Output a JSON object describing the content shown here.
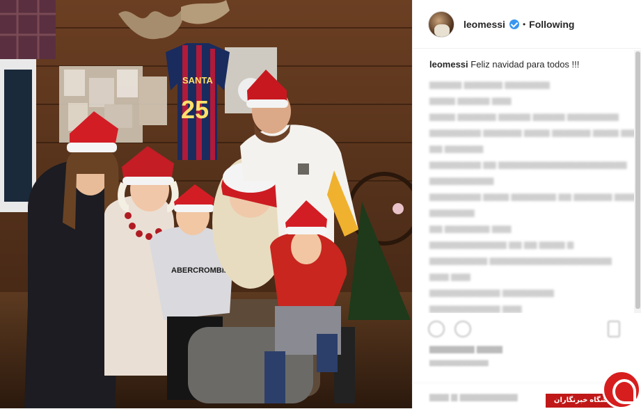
{
  "post": {
    "username": "leomessi",
    "follow_status": "Following",
    "separator": "•",
    "caption_user": "leomessi",
    "caption_text": "Feliz navidad para todos !!!"
  },
  "photo": {
    "jersey_name": "SANTA",
    "jersey_number": "25",
    "shirt_text": "ABERCROMBIE"
  },
  "watermark": {
    "text": "باشگاه خبرنگاران"
  },
  "colors": {
    "verified": "#3897f0",
    "watermark_red": "#d71e1e"
  }
}
